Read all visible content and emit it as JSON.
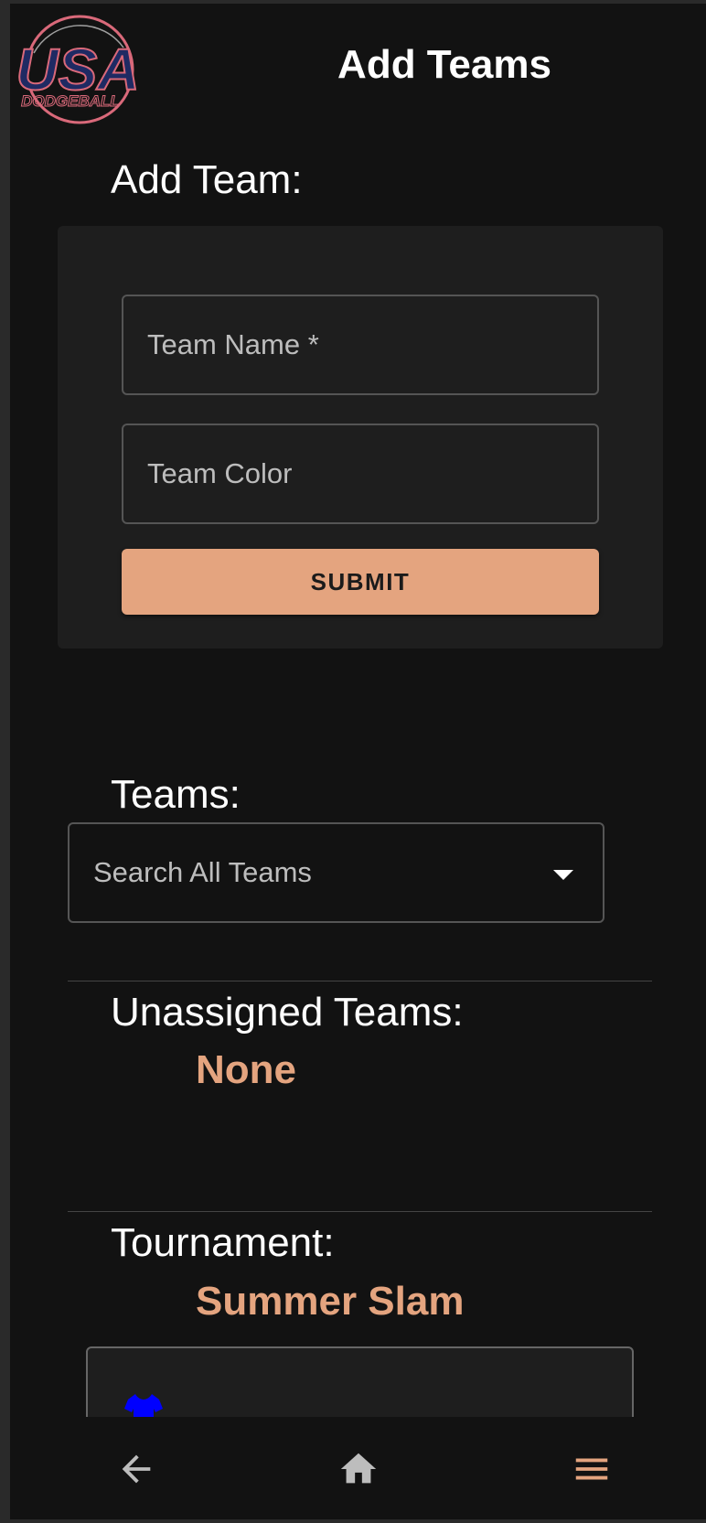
{
  "header": {
    "title": "Add Teams",
    "logo": {
      "text_top": "USA",
      "text_bottom": "DODGEBALL",
      "primary": "#1f2a63",
      "accent": "#d9697a"
    }
  },
  "add_team": {
    "label": "Add Team:",
    "team_name_placeholder": "Team Name *",
    "team_color_placeholder": "Team Color",
    "submit_label": "SUBMIT"
  },
  "teams": {
    "label": "Teams:",
    "search_placeholder": "Search All Teams"
  },
  "unassigned": {
    "label": "Unassigned Teams:",
    "value": "None"
  },
  "tournament": {
    "label": "Tournament:",
    "value": "Summer Slam",
    "team_shirt_color": "#0000ff"
  },
  "nav": {
    "back_icon": "arrow-left-icon",
    "home_icon": "home-icon",
    "menu_icon": "hamburger-menu-icon"
  },
  "colors": {
    "accent": "#e4a47f",
    "background": "#121212",
    "card": "#1e1e1e"
  }
}
